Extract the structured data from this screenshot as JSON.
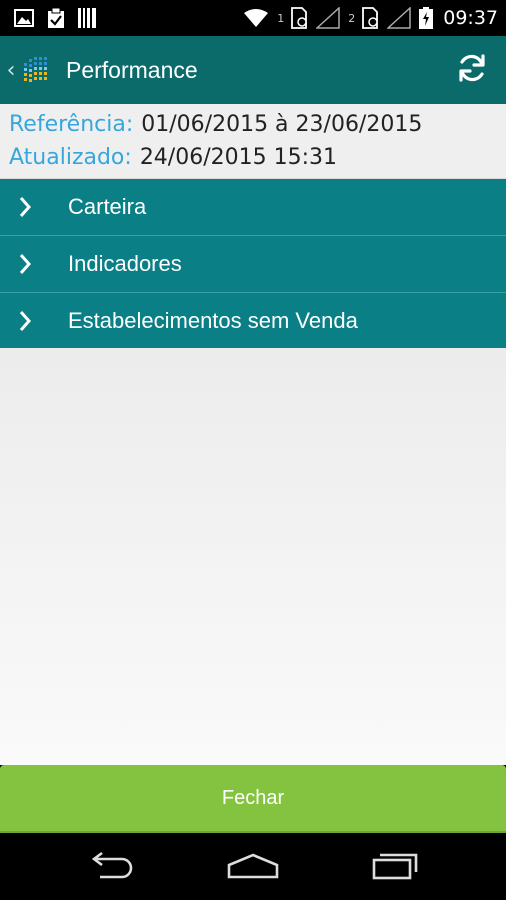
{
  "status_bar": {
    "sim1": "1",
    "sim2": "2",
    "time": "09:37"
  },
  "app_bar": {
    "title": "Performance",
    "brand_color": "#0b6b6b"
  },
  "info": {
    "reference_label": "Referência:",
    "reference_value": "01/06/2015 à 23/06/2015",
    "updated_label": "Atualizado:",
    "updated_value": "24/06/2015 15:31",
    "label_color": "#35a7dd"
  },
  "menu": {
    "items": [
      {
        "label": "Carteira"
      },
      {
        "label": "Indicadores"
      },
      {
        "label": "Estabelecimentos sem Venda"
      }
    ],
    "row_color": "#0b7f86"
  },
  "footer": {
    "close_label": "Fechar",
    "button_color": "#84c340"
  },
  "icons": {
    "status_left": [
      "image-icon",
      "clipboard-icon",
      "barcode-icon"
    ],
    "status_right": [
      "wifi-icon",
      "sim1-icon",
      "signal1-icon",
      "sim2-icon",
      "signal2-icon",
      "battery-icon"
    ],
    "app_bar": [
      "back-icon",
      "app-logo-icon",
      "refresh-icon"
    ],
    "nav": [
      "nav-back-icon",
      "nav-home-icon",
      "nav-recents-icon"
    ]
  }
}
